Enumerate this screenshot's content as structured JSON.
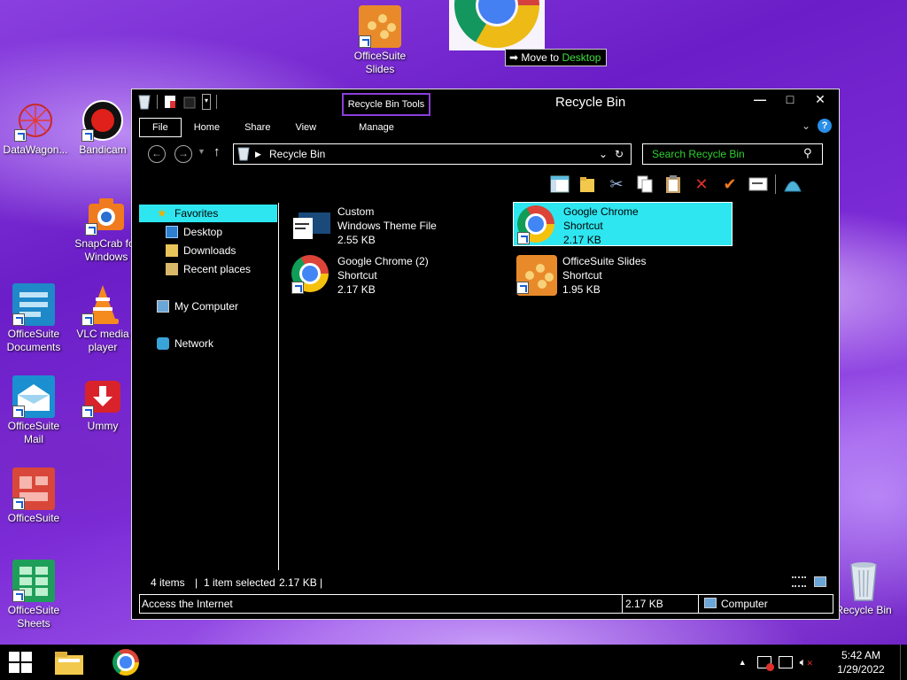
{
  "desktop": {
    "icons": [
      {
        "label": "DataWagon..."
      },
      {
        "label": "Bandicam"
      },
      {
        "label": "SnapCrab for Windows"
      },
      {
        "label": "OfficeSuite Documents"
      },
      {
        "label": "VLC media player"
      },
      {
        "label": "OfficeSuite Mail"
      },
      {
        "label": "Ummy"
      },
      {
        "label": "OfficeSuite"
      },
      {
        "label": "OfficeSuite Sheets"
      },
      {
        "label": "OfficeSuite Slides"
      },
      {
        "label": "Recycle Bin"
      }
    ]
  },
  "drag": {
    "tip_prefix": "Move to",
    "tip_destination": "Desktop"
  },
  "window": {
    "title": "Recycle Bin",
    "context_tab": "Recycle Bin Tools",
    "ribbon_tabs": [
      "File",
      "Home",
      "Share",
      "View",
      "Manage"
    ],
    "help_label": "?",
    "address": "Recycle Bin",
    "search_placeholder": "Search Recycle Bin",
    "nav": {
      "favorites": "Favorites",
      "desktop": "Desktop",
      "downloads": "Downloads",
      "recent": "Recent places",
      "computer": "My Computer",
      "network": "Network"
    },
    "files": [
      {
        "name": "Custom",
        "type": "Windows Theme File",
        "size": "2.55 KB"
      },
      {
        "name": "Google Chrome",
        "type": "Shortcut",
        "size": "2.17 KB"
      },
      {
        "name": "Google Chrome (2)",
        "type": "Shortcut",
        "size": "2.17 KB"
      },
      {
        "name": "OfficeSuite Slides",
        "type": "Shortcut",
        "size": "1.95 KB"
      }
    ],
    "status": {
      "items": "4 items",
      "selected": "1 item selected",
      "selected_size": "2.17 KB"
    },
    "details": {
      "description": "Access the Internet",
      "size": "2.17 KB",
      "location": "Computer"
    }
  },
  "taskbar": {
    "time": "5:42 AM",
    "date": "1/29/2022"
  },
  "colors": {
    "selection": "#2ee6f0",
    "accent": "#8b3fd9",
    "search_text": "#2fd02f"
  }
}
